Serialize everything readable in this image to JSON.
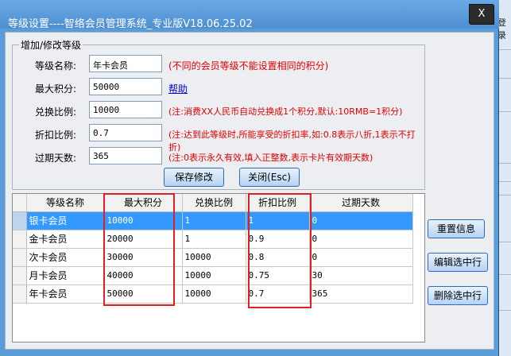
{
  "window": {
    "title": "等级设置----智络会员管理系统_专业版V18.06.25.02",
    "close_label": "X"
  },
  "background": {
    "text": "登录"
  },
  "form": {
    "group_title": "增加/修改等级",
    "fields": [
      {
        "label": "等级名称:",
        "value": "年卡会员",
        "hint": "(不同的会员等级不能设置相同的积分)"
      },
      {
        "label": "最大积分:",
        "value": "50000",
        "link": "帮助"
      },
      {
        "label": "兑换比例:",
        "value": "10000",
        "hint": "(注:消费XX人民币自动兑换成1个积分,默认:10RMB=1积分)"
      },
      {
        "label": "折扣比例:",
        "value": "0.7",
        "hint": "(注:达到此等级时,所能享受的折扣率,如:0.8表示八折,1表示不打折)"
      },
      {
        "label": "过期天数:",
        "value": "365",
        "hint": "(注:0表示永久有效,填入正整数,表示卡片有效期天数)"
      }
    ],
    "save_label": "保存修改",
    "close_label": "关闭(Esc)"
  },
  "grid": {
    "columns": [
      "等级名称",
      "最大积分",
      "兑换比例",
      "折扣比例",
      "过期天数"
    ],
    "rows": [
      {
        "name": "银卡会员",
        "max": "10000",
        "ratio": "1",
        "discount": "1",
        "expire": "0",
        "selected": true
      },
      {
        "name": "金卡会员",
        "max": "20000",
        "ratio": "1",
        "discount": "0.9",
        "expire": "0"
      },
      {
        "name": "次卡会员",
        "max": "30000",
        "ratio": "10000",
        "discount": "0.8",
        "expire": "0"
      },
      {
        "name": "月卡会员",
        "max": "40000",
        "ratio": "10000",
        "discount": "0.75",
        "expire": "30"
      },
      {
        "name": "年卡会员",
        "max": "50000",
        "ratio": "10000",
        "discount": "0.7",
        "expire": "365"
      }
    ]
  },
  "side_buttons": {
    "reset_label": "重置信息",
    "edit_label": "编辑选中行",
    "delete_label": "删除选中行"
  },
  "colors": {
    "titlebar": "#5a9bd8",
    "selected_row": "#3399ff",
    "hint_red": "#e00000",
    "highlight_red": "#e02020"
  }
}
